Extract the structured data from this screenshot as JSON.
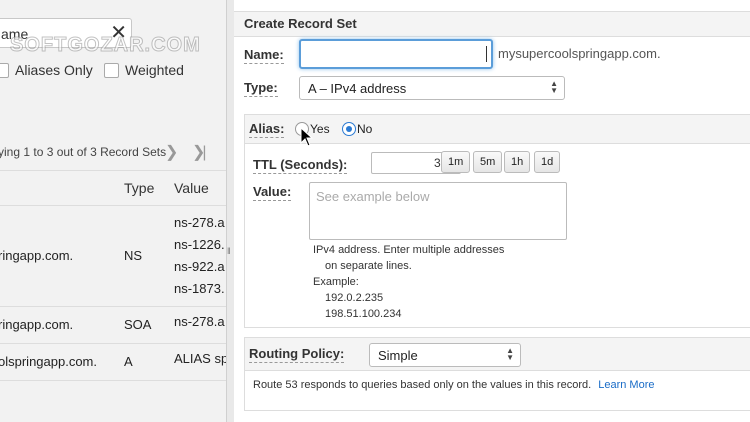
{
  "left_panel": {
    "search_value": "ame",
    "filters": {
      "aliases_only": "Aliases Only",
      "weighted": "Weighted"
    },
    "paging_text": "ying 1 to 3 out of 3 Record Sets",
    "columns": {
      "type": "Type",
      "value": "Value"
    },
    "rows": [
      {
        "name": "ringapp.com.",
        "type": "NS",
        "values": [
          "ns-278.a",
          "ns-1226.",
          "ns-922.a",
          "ns-1873."
        ]
      },
      {
        "name": "ringapp.com.",
        "type": "SOA",
        "values": [
          "ns-278.a"
        ]
      },
      {
        "name": "olspringapp.com.",
        "type": "A",
        "values": [
          "ALIAS sp"
        ]
      }
    ]
  },
  "form": {
    "title": "Create Record Set",
    "name_label": "Name:",
    "name_value": "",
    "domain_suffix": "mysupercoolspringapp.com.",
    "type_label": "Type:",
    "type_value": "A – IPv4 address",
    "alias_label": "Alias:",
    "alias_yes": "Yes",
    "alias_no": "No",
    "alias_selected": "No",
    "ttl_label": "TTL (Seconds):",
    "ttl_value": "300",
    "ttl_buttons": [
      "1m",
      "5m",
      "1h",
      "1d"
    ],
    "value_label": "Value:",
    "value_placeholder": "See example below",
    "help_lines": [
      "IPv4 address. Enter multiple addresses",
      "on separate lines.",
      "Example:",
      "192.0.2.235",
      "198.51.100.234"
    ],
    "routing_label": "Routing Policy:",
    "routing_value": "Simple",
    "routing_description": "Route 53 responds to queries based only on the values in this record.",
    "learn_more": "Learn More"
  },
  "watermark": "SOFTGOZAR.COM",
  "icons": {
    "clear": "close-icon",
    "next": "chevron-right-icon",
    "last": "last-page-icon",
    "select": "select-arrows-icon",
    "pointer": "mouse-pointer-icon"
  }
}
